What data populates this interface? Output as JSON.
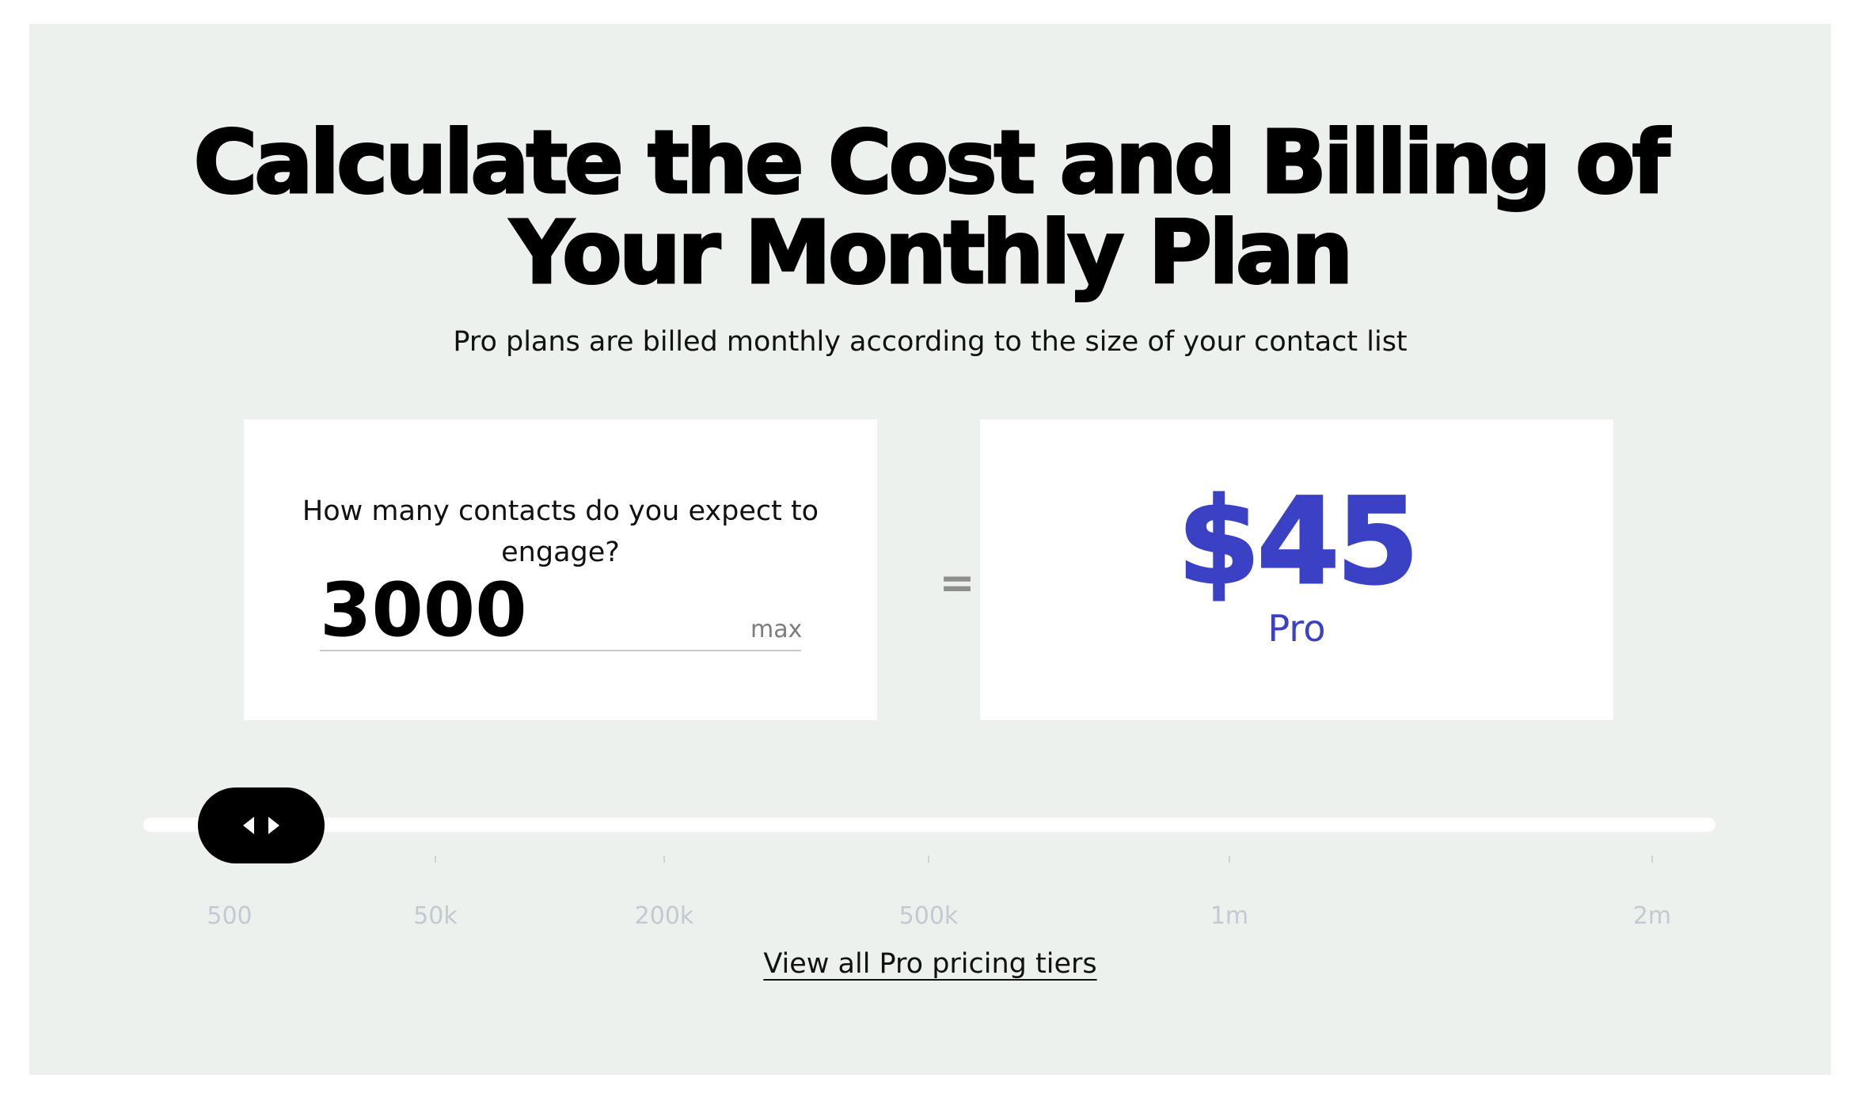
{
  "header": {
    "title_line1": "Calculate the Cost and Billing of",
    "title_line2": "Your Monthly Plan",
    "subtitle": "Pro plans are billed monthly according to the size of your contact list"
  },
  "calculator": {
    "question": "How many contacts do you expect to engage?",
    "contacts_value": "3000",
    "max_label": "max",
    "equals_sign": "=",
    "price": "$45",
    "plan_name": "Pro"
  },
  "slider": {
    "value": 3000,
    "tick_labels": [
      "500",
      "50k",
      "200k",
      "500k",
      "1m",
      "2m"
    ],
    "handle_icon": "left-right-arrows-icon"
  },
  "footer": {
    "link_label": "View all Pro pricing tiers"
  },
  "colors": {
    "panel_background": "#edf1ee",
    "accent": "#3b41c5",
    "tick_label": "#c3c9d1"
  }
}
